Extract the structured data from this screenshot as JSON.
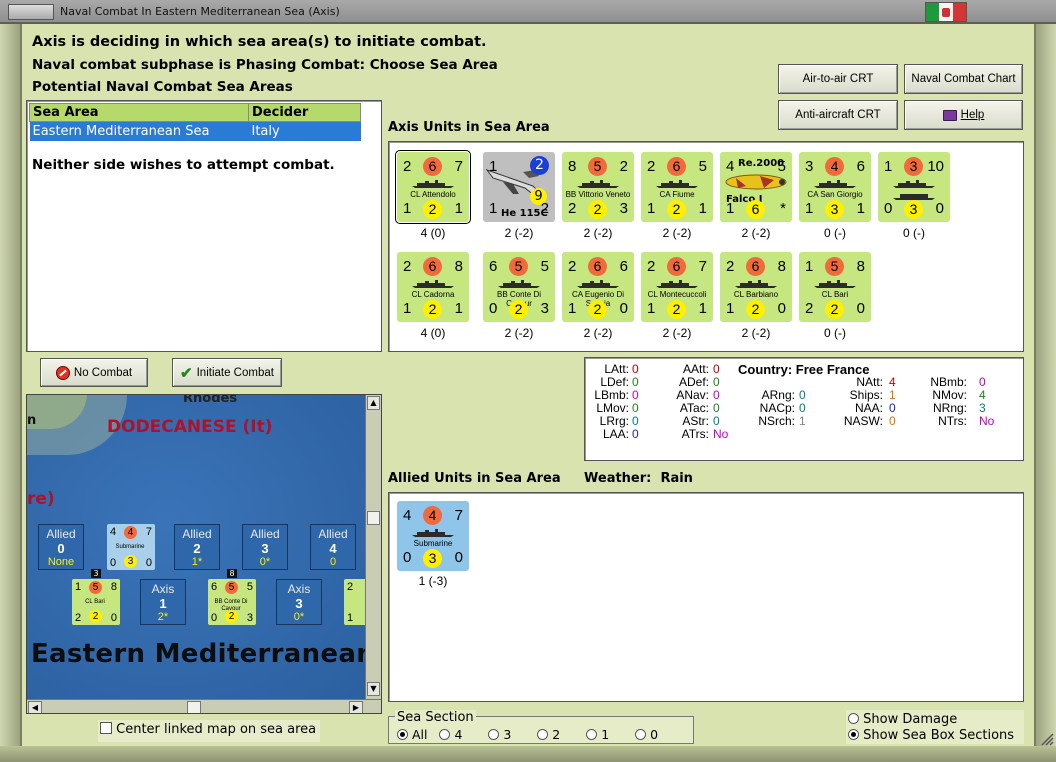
{
  "window": {
    "title": "Naval Combat In Eastern Mediterranean Sea (Axis)"
  },
  "header": {
    "line1": "Axis is deciding in which sea area(s) to initiate combat.",
    "line2": "Naval combat subphase is Phasing Combat: Choose Sea Area",
    "line3": "Potential Naval Combat Sea Areas"
  },
  "toolbar": {
    "air_to_air": "Air-to-air CRT",
    "naval_chart": "Naval Combat Chart",
    "anti_aircraft": "Anti-aircraft CRT",
    "help": "Help"
  },
  "sea_table": {
    "columns": [
      "Sea Area",
      "Decider"
    ],
    "rows": [
      {
        "sea_area": "Eastern Mediterranean Sea",
        "decider": "Italy"
      }
    ]
  },
  "message": "Neither side wishes to attempt combat.",
  "buttons": {
    "no_combat": "No Combat",
    "initiate_combat": "Initiate Combat"
  },
  "axis_units": {
    "label": "Axis Units in Sea Area",
    "units": [
      {
        "tl": "2",
        "red": "6",
        "tr": "7",
        "name": "CL Attendolo",
        "bl": "1",
        "yel": "2",
        "br": "1",
        "caption": "4 (0)"
      },
      {
        "tl": "1",
        "red": "2",
        "tr": "",
        "name": "He 115C",
        "bl": "1",
        "yel": "9",
        "br": "2",
        "caption": "2 (-2)"
      },
      {
        "tl": "8",
        "red": "5",
        "tr": "2",
        "name": "BB Vittorio Veneto",
        "bl": "2",
        "yel": "2",
        "br": "3",
        "caption": "2 (-2)"
      },
      {
        "tl": "2",
        "red": "6",
        "tr": "5",
        "name": "CA Fiume",
        "bl": "1",
        "yel": "2",
        "br": "1",
        "caption": "2 (-2)"
      },
      {
        "tl": "4",
        "red": "",
        "tr": "5",
        "name": "Falco I",
        "bl": "1",
        "yel": "6",
        "br": "*",
        "caption": "2 (-2)",
        "extra": "Re.2000"
      },
      {
        "tl": "3",
        "red": "4",
        "tr": "6",
        "name": "CA San Giorgio",
        "bl": "1",
        "yel": "3",
        "br": "1",
        "caption": "0 (-)"
      },
      {
        "tl": "1",
        "red": "3",
        "tr": "10",
        "name": "",
        "bl": "0",
        "yel": "3",
        "br": "0",
        "caption": "0 (-)"
      },
      {
        "tl": "2",
        "red": "6",
        "tr": "8",
        "name": "CL Cadorna",
        "bl": "1",
        "yel": "2",
        "br": "1",
        "caption": "4 (0)"
      },
      {
        "tl": "6",
        "red": "5",
        "tr": "5",
        "name": "BB Conte Di Cavour",
        "bl": "0",
        "yel": "2",
        "br": "3",
        "caption": "2 (-2)"
      },
      {
        "tl": "2",
        "red": "6",
        "tr": "6",
        "name": "CA Eugenio Di Savoia",
        "bl": "1",
        "yel": "2",
        "br": "0",
        "caption": "2 (-2)"
      },
      {
        "tl": "2",
        "red": "6",
        "tr": "7",
        "name": "CL Montecuccoli",
        "bl": "1",
        "yel": "2",
        "br": "1",
        "caption": "2 (-2)"
      },
      {
        "tl": "2",
        "red": "6",
        "tr": "8",
        "name": "CL Barbiano",
        "bl": "1",
        "yel": "2",
        "br": "0",
        "caption": "2 (-2)"
      },
      {
        "tl": "1",
        "red": "5",
        "tr": "8",
        "name": "CL Bari",
        "bl": "2",
        "yel": "2",
        "br": "0",
        "caption": "0 (-)"
      }
    ]
  },
  "stats": {
    "country_label": "Country: Free France",
    "col1": [
      {
        "k": "LAtt:",
        "v": "0"
      },
      {
        "k": "LDef:",
        "v": "0"
      },
      {
        "k": "LBmb:",
        "v": "0"
      },
      {
        "k": "LMov:",
        "v": "0"
      },
      {
        "k": "LRrg:",
        "v": "0"
      },
      {
        "k": "LAA:",
        "v": "0"
      }
    ],
    "col2": [
      {
        "k": "AAtt:",
        "v": "0"
      },
      {
        "k": "ADef:",
        "v": "0"
      },
      {
        "k": "ANav:",
        "v": "0"
      },
      {
        "k": "ATac:",
        "v": "0"
      },
      {
        "k": "AStr:",
        "v": "0"
      },
      {
        "k": "ATrs:",
        "v": "No"
      }
    ],
    "col3": [
      {
        "k": "ARng:",
        "v": "0"
      },
      {
        "k": "NACp:",
        "v": "0"
      },
      {
        "k": "NSrch:",
        "v": "1"
      }
    ],
    "col4": [
      {
        "k": "NAtt:",
        "v": "4"
      },
      {
        "k": "Ships:",
        "v": "1"
      },
      {
        "k": "NAA:",
        "v": "0"
      },
      {
        "k": "NASW:",
        "v": "0"
      }
    ],
    "col5": [
      {
        "k": "NBmb:",
        "v": "0"
      },
      {
        "k": "NMov:",
        "v": "4"
      },
      {
        "k": "NRng:",
        "v": "3"
      },
      {
        "k": "NTrs:",
        "v": "No"
      }
    ],
    "colors": {
      "zero": "#c00000",
      "lav": "#c000c0",
      "teal": "#008080",
      "green": "#208020",
      "orange": "#e07000",
      "gray": "#888888",
      "blue": "#2020c0"
    }
  },
  "allied_units": {
    "label": "Allied Units in Sea Area",
    "weather_label": "Weather:",
    "weather_value": "Rain",
    "units": [
      {
        "tl": "4",
        "red": "4",
        "tr": "7",
        "name": "Submarine",
        "bl": "0",
        "yel": "3",
        "br": "0",
        "caption": "1 (-3)"
      }
    ]
  },
  "map": {
    "labels": {
      "rhodes": "Rhodes",
      "dodecanese": "DODECANESE (It)",
      "left_partial": "re)",
      "left_partial2": "n",
      "sea": "Eastern Mediterranean"
    },
    "allied_boxes": [
      {
        "a": "Allied",
        "b": "0",
        "c": "None"
      },
      {
        "a": "Allied",
        "b": "2",
        "c": "1*"
      },
      {
        "a": "Allied",
        "b": "3",
        "c": "0*"
      },
      {
        "a": "Allied",
        "b": "4",
        "c": "0"
      }
    ],
    "axis_boxes": [
      {
        "a": "Axis",
        "b": "1",
        "c": "2*"
      },
      {
        "a": "Axis",
        "b": "3",
        "c": "0*"
      }
    ],
    "mini_sub": {
      "tl": "4",
      "red": "4",
      "tr": "7",
      "name": "Submarine",
      "bl": "0",
      "yel": "3",
      "br": "0"
    },
    "mini_bari": {
      "tl": "1",
      "red": "5",
      "tr": "8",
      "name": "CL Bari",
      "bl": "2",
      "yel": "2",
      "br": "0",
      "stack": "3"
    },
    "mini_cavour": {
      "tl": "6",
      "red": "5",
      "tr": "5",
      "name": "BB Conte Di Cavour",
      "bl": "0",
      "yel": "2",
      "br": "3",
      "stack": "8"
    },
    "mini_edge": {
      "tl": "2",
      "bl": "1"
    }
  },
  "center_map_label": "Center linked map on sea area",
  "sea_section": {
    "label": "Sea Section",
    "options": [
      "All",
      "4",
      "3",
      "2",
      "1",
      "0"
    ],
    "selected": "All"
  },
  "display_options": {
    "show_damage": "Show Damage",
    "show_sea_box": "Show Sea Box Sections",
    "selected": "Show Sea Box Sections"
  }
}
